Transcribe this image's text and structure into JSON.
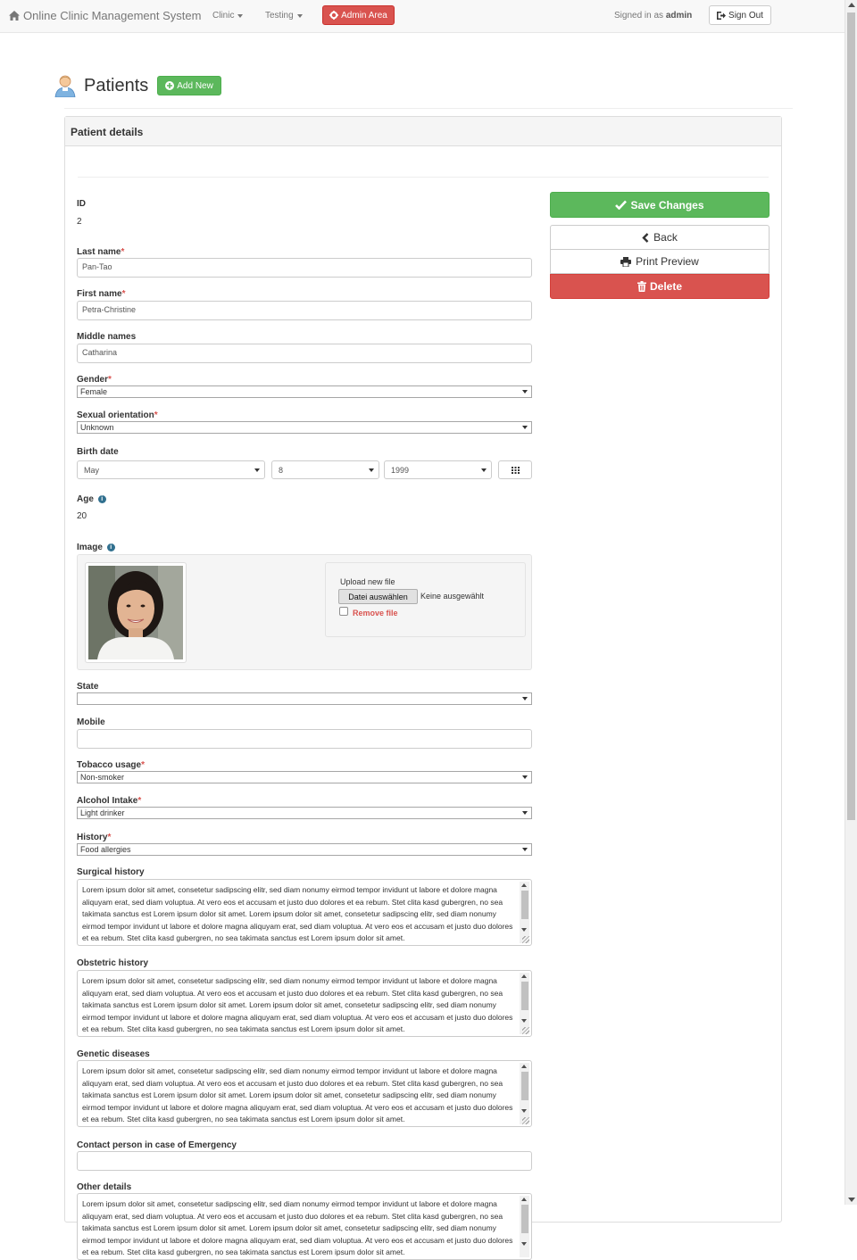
{
  "navbar": {
    "brand": "Online Clinic Management System",
    "menu_clinic": "Clinic",
    "menu_testing": "Testing",
    "admin_area": "Admin Area",
    "signed_in_prefix": "Signed in as",
    "signed_in_user": "admin",
    "sign_out": "Sign Out"
  },
  "header": {
    "title": "Patients",
    "add_new": "Add New"
  },
  "panel": {
    "heading": "Patient details"
  },
  "form": {
    "id_label": "ID",
    "id_value": "2",
    "last_name_label": "Last name",
    "last_name_value": "Pan-Tao",
    "first_name_label": "First name",
    "first_name_value": "Petra-Christine",
    "middle_names_label": "Middle names",
    "middle_names_value": "Catharina",
    "gender_label": "Gender",
    "gender_value": "Female",
    "sexual_orientation_label": "Sexual orientation",
    "sexual_orientation_value": "Unknown",
    "birth_date_label": "Birth date",
    "birth_month": "May",
    "birth_day": "8",
    "birth_year": "1999",
    "age_label": "Age",
    "age_value": "20",
    "image_label": "Image",
    "upload_label": "Upload new file",
    "file_button": "Datei auswählen",
    "file_status": "Keine ausgewählt",
    "remove_file": "Remove file",
    "state_label": "State",
    "state_value": "",
    "mobile_label": "Mobile",
    "mobile_value": "",
    "tobacco_label": "Tobacco usage",
    "tobacco_value": "Non-smoker",
    "alcohol_label": "Alcohol Intake",
    "alcohol_value": "Light drinker",
    "history_label": "History",
    "history_value": "Food allergies",
    "surgical_label": "Surgical history",
    "obstetric_label": "Obstetric history",
    "genetic_label": "Genetic diseases",
    "emergency_label": "Contact person in case of Emergency",
    "emergency_value": "",
    "other_label": "Other details",
    "lorem": "Lorem ipsum dolor sit amet, consetetur sadipscing elitr, sed diam nonumy eirmod tempor invidunt ut labore et dolore magna aliquyam erat, sed diam voluptua. At vero eos et accusam et justo duo dolores et ea rebum. Stet clita kasd gubergren, no sea takimata sanctus est Lorem ipsum dolor sit amet. Lorem ipsum dolor sit amet, consetetur sadipscing elitr, sed diam nonumy eirmod tempor invidunt ut labore et dolore magna aliquyam erat, sed diam voluptua. At vero eos et accusam et justo duo dolores et ea rebum. Stet clita kasd gubergren, no sea takimata sanctus est Lorem ipsum dolor sit amet."
  },
  "actions": {
    "save": "Save Changes",
    "back": "Back",
    "print": "Print Preview",
    "delete": "Delete"
  },
  "colors": {
    "success": "#5cb85c",
    "danger": "#d9534f",
    "info": "#31708f"
  }
}
